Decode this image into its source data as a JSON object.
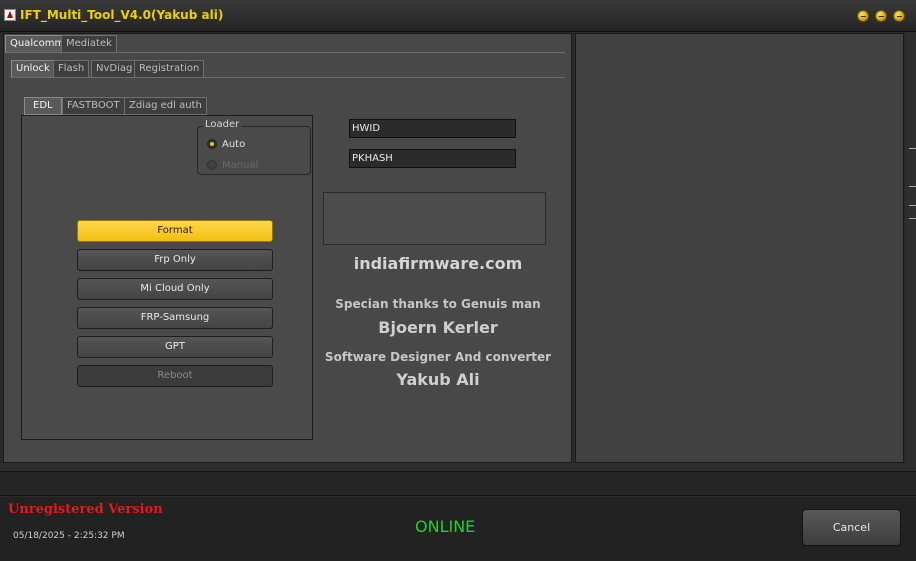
{
  "window": {
    "title": "IFT_Multi_Tool_V4.0(Yakub ali)",
    "accent_color": "#f0d000",
    "controls": [
      "minimize-icon",
      "maximize-icon",
      "close-icon"
    ]
  },
  "platform_tabs": [
    {
      "label": "Qualcomm",
      "active": true
    },
    {
      "label": "Mediatek",
      "active": false
    }
  ],
  "function_tabs": [
    {
      "label": "Unlock",
      "active": true
    },
    {
      "label": "Flash",
      "active": false
    },
    {
      "label": "NvDiag",
      "active": false
    },
    {
      "label": "Registration",
      "active": false
    }
  ],
  "mode_tabs": [
    {
      "label": "EDL",
      "active": true
    },
    {
      "label": "FASTBOOT",
      "active": false
    },
    {
      "label": "Zdiag edl auth",
      "active": false
    }
  ],
  "loader": {
    "group_label": "Loader",
    "options": [
      {
        "label": "Auto",
        "selected": true,
        "enabled": true
      },
      {
        "label": "Manual",
        "selected": false,
        "enabled": false
      }
    ]
  },
  "actions": [
    {
      "label": "Format",
      "highlighted": true,
      "enabled": true
    },
    {
      "label": "Frp Only",
      "highlighted": false,
      "enabled": true
    },
    {
      "label": "Mi Cloud Only",
      "highlighted": false,
      "enabled": true
    },
    {
      "label": "FRP-Samsung",
      "highlighted": false,
      "enabled": true
    },
    {
      "label": "GPT",
      "highlighted": false,
      "enabled": true
    },
    {
      "label": "Reboot",
      "highlighted": false,
      "enabled": false
    }
  ],
  "fields": {
    "hwid": "HWID",
    "pkhash": "PKHASH"
  },
  "credits": {
    "site": "indiafirmware.com",
    "thanks": "Specian thanks to Genuis man",
    "name1": "Bjoern Kerler",
    "designer": "Software Designer And converter",
    "name2": "Yakub Ali"
  },
  "status": {
    "registration": "Unregistered Version",
    "datetime": "05/18/2025 - 2:25:32 PM",
    "connection": "ONLINE",
    "registration_color": "#e21b1b",
    "online_color": "#1fd22c"
  },
  "cancel_label": "Cancel"
}
